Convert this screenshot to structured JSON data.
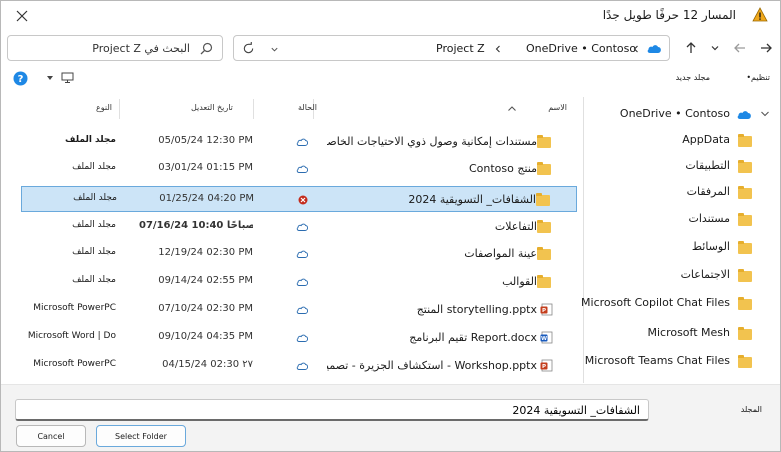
{
  "titlebar": {
    "title": "المسار 12 حرفًا طويل جدًا"
  },
  "address": {
    "crumbs": [
      "OneDrive • Contoso",
      "Project Z"
    ],
    "search_placeholder": "البحث في Project Z"
  },
  "command_bar": {
    "organize": "تنظيم•",
    "new_folder": "مجلد جديد"
  },
  "sidebar": {
    "root": "OneDrive • Contoso",
    "items": [
      "AppData",
      "التطبيقات",
      "المرفقات",
      "مستندات",
      "الوسائط",
      "الاجتماعات",
      "Microsoft Copilot Chat Files",
      "Microsoft Mesh",
      "Microsoft Teams Chat Files"
    ]
  },
  "columns": {
    "name": "الاسم",
    "status": "الحالة",
    "modified": "تاريخ التعديل",
    "type": "النوع"
  },
  "rows": [
    {
      "name": "مستندات إمكانية وصول ذوي الاحتياجات الخاصة",
      "date": "05/05/24 12:30 PM",
      "type": "مجلد الملف",
      "kind": "folder",
      "status": "cloud",
      "type_bold": true
    },
    {
      "name": "منتج Contoso",
      "date": "03/01/24 01:15 PM",
      "type": "مجلد الملف",
      "kind": "folder",
      "status": "cloud"
    },
    {
      "name": "الشفافات_ التسويقية 2024",
      "date": "01/25/24 04:20 PM",
      "type": "مجلد الملف",
      "kind": "folder",
      "status": "error",
      "selected": true
    },
    {
      "name": "التفاعلات",
      "date": "07/16/24 10:40 صباحًا",
      "type": "مجلد الملف",
      "kind": "folder",
      "status": "cloud",
      "date_bold": true
    },
    {
      "name": "عينة المواصفات",
      "date": "12/19/24 02:30 PM",
      "type": "مجلد الملف",
      "kind": "folder",
      "status": "cloud"
    },
    {
      "name": "القوالب",
      "date": "09/14/24 02:55 PM",
      "type": "مجلد الملف",
      "kind": "folder",
      "status": "cloud"
    },
    {
      "name": "storytelling.pptx المنتج",
      "date": "07/10/24 02:30 PM",
      "type": "Microsoft PowerPC",
      "kind": "pptx",
      "status": "cloud"
    },
    {
      "name": "Report.docx تقيم البرنامج",
      "date": "09/10/24 04:35 PM",
      "type": "Microsoft Word | Do",
      "kind": "docx",
      "status": "cloud"
    },
    {
      "name": "Workshop.pptx - استكشاف الجزيرة - تصميم",
      "date": "04/15/24 02:30 ٢٧",
      "type": "Microsoft PowerPC",
      "kind": "pptx",
      "status": "cloud"
    }
  ],
  "footer": {
    "folder_label": "المجلد",
    "folder_value": "الشفافات_ التسويقية 2024",
    "select_label": "Select Folder",
    "cancel_label": "Cancel"
  },
  "colors": {
    "accent": "#0067c0",
    "selected_bg": "#cce4f7",
    "folder": "#f2c34f",
    "error": "#c42b1c",
    "cloud": "#2b6cb0"
  }
}
